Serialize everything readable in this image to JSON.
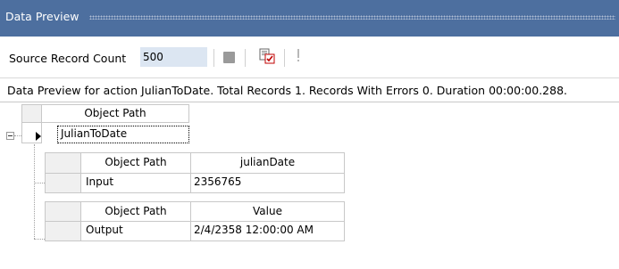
{
  "window": {
    "title": "Data Preview"
  },
  "toolbar": {
    "source_record_count_label": "Source Record Count",
    "source_record_count_value": "500",
    "icons": [
      "stop-icon",
      "preview-icon",
      "exclamation-icon"
    ]
  },
  "status": {
    "message": "Data Preview for action JulianToDate. Total Records 1. Records With Errors 0. Duration 00:00:00.288."
  },
  "grid": {
    "top": {
      "header": "Object Path",
      "row_value": "JulianToDate"
    },
    "children": [
      {
        "headers": [
          "Object Path",
          "julianDate"
        ],
        "rows": [
          [
            "Input",
            "2356765"
          ]
        ]
      },
      {
        "headers": [
          "Object Path",
          "Value"
        ],
        "rows": [
          [
            "Output",
            "2/4/2358 12:00:00 AM"
          ]
        ]
      }
    ]
  },
  "colors": {
    "titlebar": "#4d6f9f",
    "input_background": "#dce6f2",
    "grid_border": "#c8c8c8"
  }
}
